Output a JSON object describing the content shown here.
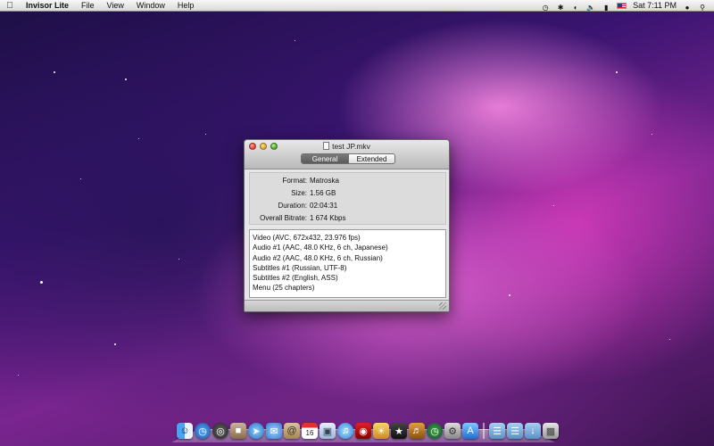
{
  "menubar": {
    "app_name": "Invisor Lite",
    "menus": [
      "File",
      "View",
      "Window",
      "Help"
    ],
    "clock": "Sat 7:11 PM"
  },
  "window": {
    "title": "test JP.mkv",
    "tabs": {
      "general": "General",
      "extended": "Extended"
    },
    "info": [
      {
        "label": "Format:",
        "value": "Matroska"
      },
      {
        "label": "Size:",
        "value": "1.56 GB"
      },
      {
        "label": "Duration:",
        "value": "02:04:31"
      },
      {
        "label": "Overall Bitrate:",
        "value": "1 674 Kbps"
      }
    ],
    "tracks": [
      "Video (AVC, 672x432, 23.976 fps)",
      "Audio #1 (AAC, 48.0 KHz, 6 ch, Japanese)",
      "Audio #2 (AAC, 48.0 KHz, 6 ch, Russian)",
      "Subtitles #1 (Russian, UTF-8)",
      "Subtitles #2 (English, ASS)",
      "Menu (25 chapters)"
    ]
  },
  "dock": {
    "calendar_day": "16",
    "apps": [
      "finder-icon",
      "dashboard-icon",
      "mission-icon",
      "photo-icon",
      "safari-icon",
      "ichat-icon",
      "address-book-icon",
      "ical-icon",
      "preview-icon",
      "itunes-icon",
      "photo-booth-icon",
      "iphoto-icon",
      "imovie-icon",
      "garageband-icon",
      "time-machine-icon",
      "system-preferences-icon",
      "app-store-icon",
      "applications-folder-icon",
      "documents-folder-icon",
      "downloads-folder-icon",
      "trash-icon"
    ]
  }
}
